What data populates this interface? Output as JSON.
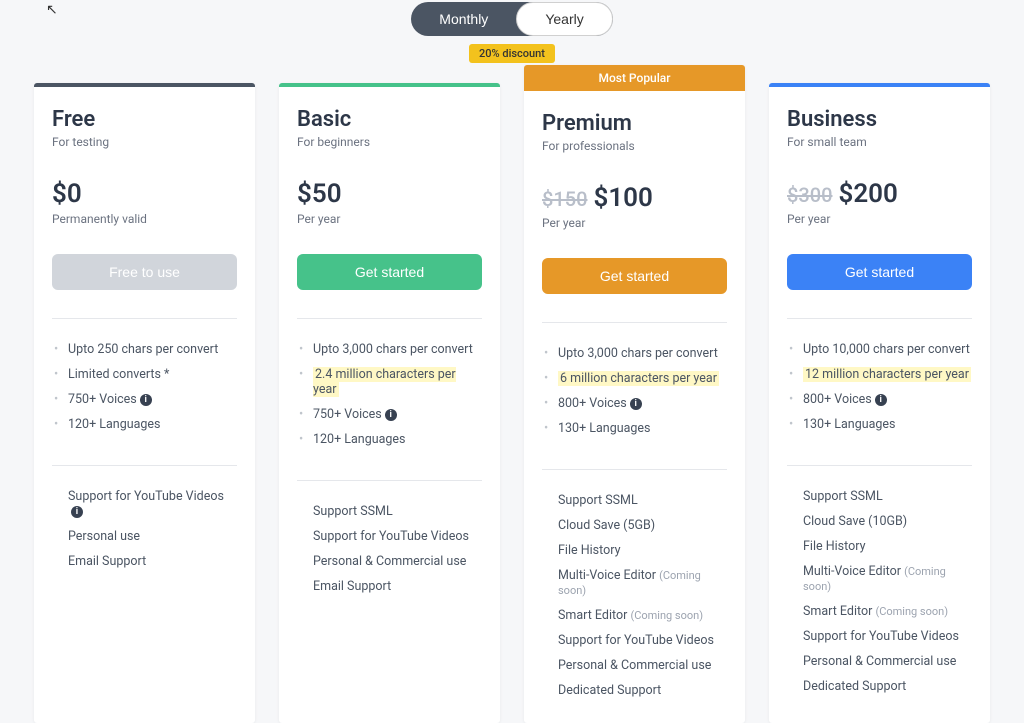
{
  "toggle": {
    "monthly": "Monthly",
    "yearly": "Yearly"
  },
  "discount": "20% discount",
  "popular_label": "Most Popular",
  "plans": [
    {
      "name": "Free",
      "sub": "For testing",
      "old": "",
      "price": "$0",
      "period": "Permanently valid",
      "cta": "Free to use",
      "f1": [
        "Upto 250 chars per convert",
        "Limited converts *",
        "750+ Voices",
        "120+ Languages"
      ],
      "f1_info": [
        false,
        false,
        true,
        false
      ],
      "f1_hl": [
        false,
        false,
        false,
        false
      ],
      "f2": [
        "Support for YouTube Videos",
        "Personal use",
        "Email Support"
      ],
      "f2_info": [
        true,
        false,
        false
      ],
      "f2_soon": [
        false,
        false,
        false
      ]
    },
    {
      "name": "Basic",
      "sub": "For beginners",
      "old": "",
      "price": "$50",
      "period": "Per year",
      "cta": "Get started",
      "f1": [
        "Upto 3,000 chars per convert",
        "2.4 million characters per year",
        "750+ Voices",
        "120+ Languages"
      ],
      "f1_info": [
        false,
        false,
        true,
        false
      ],
      "f1_hl": [
        false,
        true,
        false,
        false
      ],
      "f2": [
        "Support SSML",
        "Support for YouTube Videos",
        "Personal & Commercial use",
        "Email Support"
      ],
      "f2_info": [
        false,
        false,
        false,
        false
      ],
      "f2_soon": [
        false,
        false,
        false,
        false
      ]
    },
    {
      "name": "Premium",
      "sub": "For professionals",
      "old": "$150",
      "price": "$100",
      "period": "Per year",
      "cta": "Get started",
      "f1": [
        "Upto 3,000 chars per convert",
        "6 million characters per year",
        "800+ Voices",
        "130+ Languages"
      ],
      "f1_info": [
        false,
        false,
        true,
        false
      ],
      "f1_hl": [
        false,
        true,
        false,
        false
      ],
      "f2": [
        "Support SSML",
        "Cloud Save (5GB)",
        "File History",
        "Multi-Voice Editor",
        "Smart Editor",
        "Support for YouTube Videos",
        "Personal & Commercial use",
        "Dedicated Support"
      ],
      "f2_info": [
        false,
        false,
        false,
        false,
        false,
        false,
        false,
        false
      ],
      "f2_soon": [
        false,
        false,
        false,
        true,
        true,
        false,
        false,
        false
      ]
    },
    {
      "name": "Business",
      "sub": "For small team",
      "old": "$300",
      "price": "$200",
      "period": "Per year",
      "cta": "Get started",
      "f1": [
        "Upto 10,000 chars per convert",
        "12 million characters per year",
        "800+ Voices",
        "130+ Languages"
      ],
      "f1_info": [
        false,
        false,
        true,
        false
      ],
      "f1_hl": [
        false,
        true,
        false,
        false
      ],
      "f2": [
        "Support SSML",
        "Cloud Save (10GB)",
        "File History",
        "Multi-Voice Editor",
        "Smart Editor",
        "Support for YouTube Videos",
        "Personal & Commercial use",
        "Dedicated Support"
      ],
      "f2_info": [
        false,
        false,
        false,
        false,
        false,
        false,
        false,
        false
      ],
      "f2_soon": [
        false,
        false,
        false,
        true,
        true,
        false,
        false,
        false
      ]
    }
  ],
  "soon_label": "(Coming soon)",
  "bar_classes": [
    "bar-free",
    "bar-basic",
    "bar-premium",
    "bar-business"
  ],
  "cta_classes": [
    "cta-free",
    "cta-basic",
    "cta-premium",
    "cta-business"
  ]
}
